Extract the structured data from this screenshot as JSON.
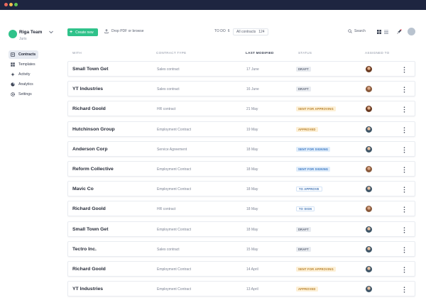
{
  "app": {
    "team_name": "Riga Team",
    "team_sub": "Juris"
  },
  "sidebar": {
    "items": [
      {
        "label": "Contracts",
        "icon": "contracts-icon",
        "active": true
      },
      {
        "label": "Templates",
        "icon": "templates-icon",
        "active": false
      },
      {
        "label": "Activity",
        "icon": "activity-icon",
        "active": false
      },
      {
        "label": "Analytics",
        "icon": "analytics-icon",
        "active": false
      },
      {
        "label": "Settings",
        "icon": "settings-icon",
        "active": false
      }
    ]
  },
  "toolbar": {
    "create_label": "Create new",
    "drop_label": "Drop PDF or browse",
    "todo_label": "TO DO",
    "todo_count": "6",
    "all_label": "All contracts",
    "all_count": "124",
    "search_label": "Search"
  },
  "table": {
    "headers": {
      "with": "WITH",
      "type": "CONTRACT TYPE",
      "modified": "LAST MODIFIED",
      "status": "STATUS",
      "assigned": "ASSIGNED TO"
    },
    "rows": [
      {
        "with": "Small Town Get",
        "type": "Sales contract",
        "modified": "17 June",
        "status": "DRAFT",
        "status_style": "draft",
        "avatar": "av-a"
      },
      {
        "with": "YT Industries",
        "type": "Sales contract",
        "modified": "16 June",
        "status": "DRAFT",
        "status_style": "draft",
        "avatar": "av-c"
      },
      {
        "with": "Richard Goold",
        "type": "HR contract",
        "modified": "21 May",
        "status": "SENT FOR APPROVING",
        "status_style": "yellow",
        "avatar": "av-a"
      },
      {
        "with": "Hutchinson Group",
        "type": "Employment Contract",
        "modified": "19 May",
        "status": "APPROVED",
        "status_style": "yellow",
        "avatar": "av-b"
      },
      {
        "with": "Anderson Corp",
        "type": "Service Agreement",
        "modified": "18 May",
        "status": "SENT FOR SIGNING",
        "status_style": "blue",
        "avatar": "av-b"
      },
      {
        "with": "Reform Collective",
        "type": "Employment Contract",
        "modified": "18 May",
        "status": "SENT FOR SIGNING",
        "status_style": "blue",
        "avatar": "av-c"
      },
      {
        "with": "Mavic Co",
        "type": "Employment Contract",
        "modified": "18 May",
        "status": "TO APPROVE",
        "status_style": "outline",
        "avatar": "av-b"
      },
      {
        "with": "Richard Goold",
        "type": "HR contract",
        "modified": "18 May",
        "status": "TO SIGN",
        "status_style": "outline",
        "avatar": "av-c"
      },
      {
        "with": "Small Town Get",
        "type": "Employment Contract",
        "modified": "18 May",
        "status": "DRAFT",
        "status_style": "draft",
        "avatar": "av-b"
      },
      {
        "with": "Tectro Inc.",
        "type": "Sales contract",
        "modified": "15 May",
        "status": "DRAFT",
        "status_style": "draft",
        "avatar": "av-b"
      },
      {
        "with": "Richard Goold",
        "type": "Employment Contract",
        "modified": "14 April",
        "status": "SENT FOR APPROVING",
        "status_style": "yellow",
        "avatar": "av-b"
      },
      {
        "with": "YT Industries",
        "type": "Employment Contract",
        "modified": "13 April",
        "status": "APPROVED",
        "status_style": "yellow",
        "avatar": "av-b"
      }
    ]
  },
  "colors": {
    "titlebar": "#1e2540",
    "accent": "#2fc28a",
    "draft": "#e8ebf0",
    "yellow": "#fdf0d6",
    "blue": "#e0edfb"
  }
}
